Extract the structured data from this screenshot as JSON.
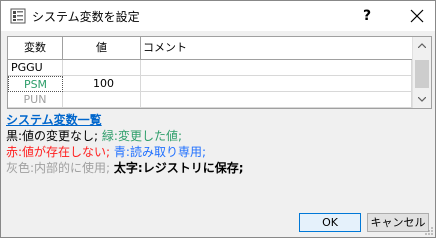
{
  "window": {
    "title": "システム変数を設定",
    "help_label": "?"
  },
  "grid": {
    "columns": [
      "変数",
      "値",
      "コメント"
    ],
    "rows": [
      {
        "name": "PGGU",
        "value": "",
        "comment": "",
        "name_color": "#000000"
      },
      {
        "name": "PSM",
        "value": "100",
        "comment": "",
        "name_color": "#2e9e6a"
      },
      {
        "name": "PUN",
        "value": "",
        "comment": "",
        "name_color": "#a0a0a0"
      }
    ]
  },
  "legend": {
    "title": "システム変数一覧",
    "line1": {
      "black": "黒:値の変更なし;",
      "green": "緑:変更した値;"
    },
    "line2": {
      "red": "赤:値が存在しない;",
      "blue": "青:読み取り専用;"
    },
    "line3": {
      "gray": "灰色:内部的に使用;",
      "bold": "太字:レジストリに保存;"
    },
    "colors": {
      "black": "#000000",
      "green": "#2e9e6a",
      "red": "#ff2020",
      "blue": "#2070ff",
      "gray": "#a0a0a0"
    }
  },
  "buttons": {
    "ok": "OK",
    "cancel": "キャンセル"
  },
  "icons": {
    "app": "settings-grid-icon",
    "close": "close-icon"
  }
}
